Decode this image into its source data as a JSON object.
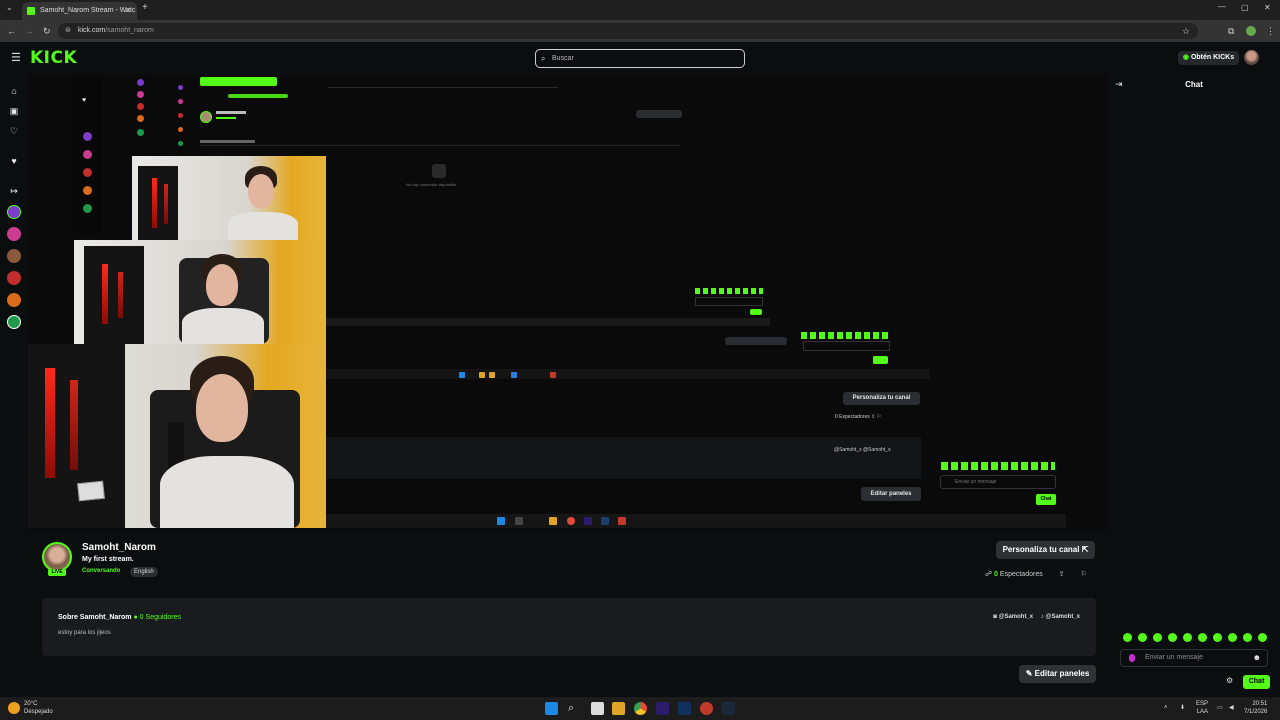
{
  "browser": {
    "tab_title": "Samoht_Narom Stream - Watc",
    "url_host": "kick.com",
    "url_path": "/samoht_narom"
  },
  "header": {
    "logo": "KICK",
    "search_placeholder": "Buscar",
    "get_kicks_label": "Obtén KICKs"
  },
  "stream_overlay": {
    "customize_label": "Personaliza tu canal",
    "viewers_label": "0 Espectadores",
    "social": "@Samoht_x  @Samoht_x",
    "edit_panels_label": "Editar paneles",
    "chat_placeholder": "Enviar un mensaje",
    "chat_send": "Chat",
    "no_content": "No hay contenido disponible"
  },
  "channel": {
    "name": "Samoht_Narom",
    "live_badge": "LIVE",
    "stream_title": "My first stream.",
    "category": "Conversando",
    "language": "English",
    "customize_label": "Personaliza tu canal",
    "viewers_count": "0",
    "viewers_label": "Espectadores",
    "about_title": "Sobre Samoht_Narom",
    "followers_label": "Seguidores",
    "followers_count": "0",
    "bio": "estoy para los jijeos",
    "social_1": "@Samoht_x",
    "social_2": "@Samoht_x",
    "edit_panels_label": "Editar paneles"
  },
  "chat": {
    "title": "Chat",
    "input_placeholder": "Enviar un mensaje",
    "send_label": "Chat"
  },
  "taskbar": {
    "weather_temp": "20°C",
    "weather_desc": "Despejado",
    "lang_1": "ESP",
    "lang_2": "LAA",
    "time": "20:51",
    "date": "7/1/2026"
  },
  "colors": {
    "brand_green": "#53fc18",
    "bg": "#0b0e0f",
    "panel": "#191b1f",
    "button": "#2f3235"
  }
}
